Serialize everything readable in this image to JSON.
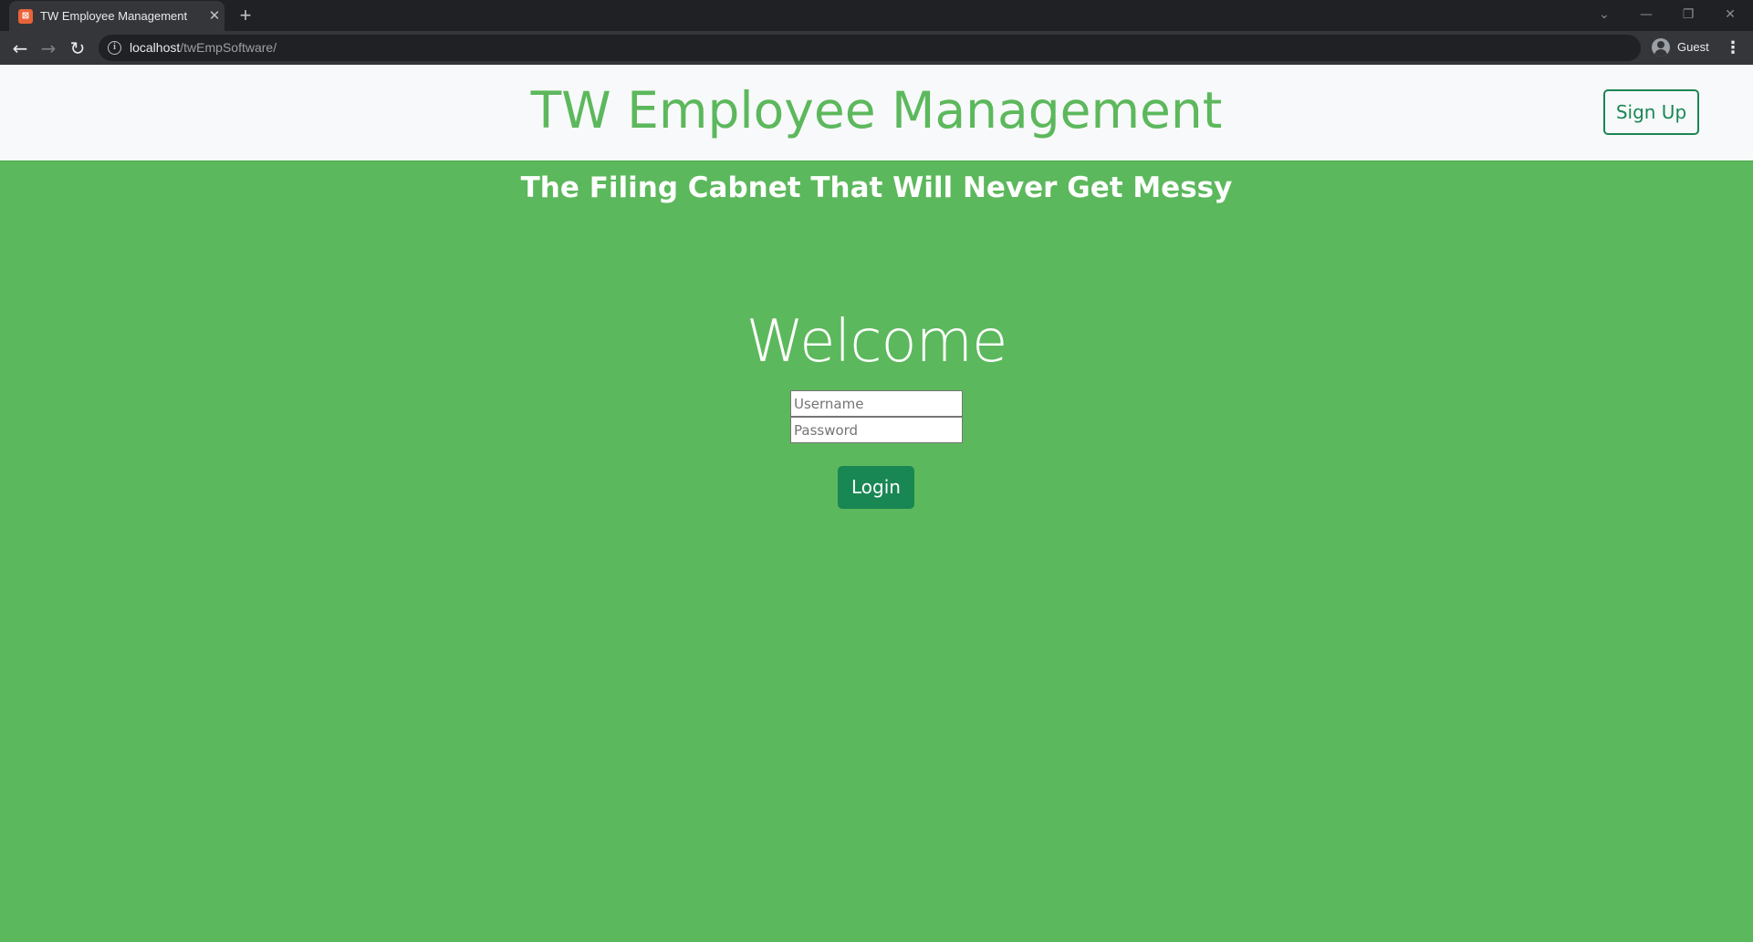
{
  "browser": {
    "tab_title": "TW Employee Management",
    "tab_close": "✕",
    "new_tab": "+",
    "url_host": "localhost",
    "url_path": "/twEmpSoftware/",
    "profile_label": "Guest",
    "icons": {
      "back": "arrow-left-icon",
      "forward": "arrow-right-icon",
      "reload": "reload-icon",
      "info": "info-icon",
      "menu": "kebab-menu-icon",
      "favicon": "xampp-favicon-icon"
    }
  },
  "navbar": {
    "brand": "TW Employee Management",
    "signup_label": "Sign Up"
  },
  "hero": {
    "tagline": "The Filing Cabnet That Will Never Get Messy",
    "welcome": "Welcome"
  },
  "login_form": {
    "username_placeholder": "Username",
    "username_value": "",
    "password_placeholder": "Password",
    "password_value": "",
    "submit_label": "Login"
  },
  "colors": {
    "page_background": "#5cb85c",
    "navbar_background": "#f8f9fa",
    "brand_text": "#5cb85c",
    "button_green": "#198754"
  }
}
